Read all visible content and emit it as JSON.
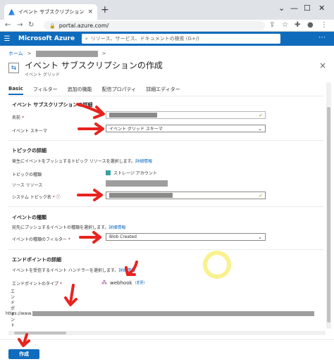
{
  "browser": {
    "tab_title": "イベント サブスクリプションの作成 - M",
    "tab_close": "×",
    "new_tab": "+",
    "url": "portal.azure.com/",
    "win_min": "—",
    "win_max": "☐",
    "win_close": "✕"
  },
  "azure": {
    "brand": "Microsoft Azure",
    "search_placeholder": "リソース、サービス、ドキュメントの検索 (G+/)",
    "more": "⋯"
  },
  "breadcrumb": {
    "home": "ホーム",
    "sep": ">"
  },
  "page": {
    "title": "イベント サブスクリプションの作成",
    "subtitle": "イベント グリッド",
    "more": "…",
    "close": "×"
  },
  "tabs": [
    {
      "label": "Basic",
      "active": true
    },
    {
      "label": "フィルター"
    },
    {
      "label": "追加の機能"
    },
    {
      "label": "配信プロパティ"
    },
    {
      "label": "詳細エディター"
    }
  ],
  "subscription": {
    "heading": "イベント サブスクリプションの詳細",
    "name_label": "名前",
    "required": "*",
    "schema_label": "イベント スキーマ",
    "schema_value": "イベント グリッド スキーマ"
  },
  "topic": {
    "heading": "トピックの詳細",
    "desc": "発生にイベントをプッシュするトピック リソースを選択します。",
    "more_link": "詳細情報",
    "type_label": "トピックの種類",
    "type_value": "ストレージ アカウント",
    "source_label": "ソース リソース",
    "system_topic_label": "システム トピック名"
  },
  "events": {
    "heading": "イベントの種類",
    "desc": "宛先にプッシュするイベントの種類を選択します。",
    "more_link": "詳細情報",
    "filter_label": "イベントの種類のフィルター",
    "filter_value": "Blob Created"
  },
  "endpoint": {
    "heading": "エンドポイントの詳細",
    "desc": "イベントを受信するイベント ハンドラーを選択します。",
    "more_link": "詳細情報",
    "type_label": "エンドポイントのタイプ",
    "type_value": "webhook",
    "type_change": "(変更)",
    "vertical_label": "エンドポイント",
    "url_prefix": "https://www."
  },
  "footer": {
    "create_label": "作成"
  },
  "colors": {
    "azure_blue": "#0f6cbd",
    "annotation_red": "#e8231f",
    "highlight": "#f8ef7a"
  }
}
